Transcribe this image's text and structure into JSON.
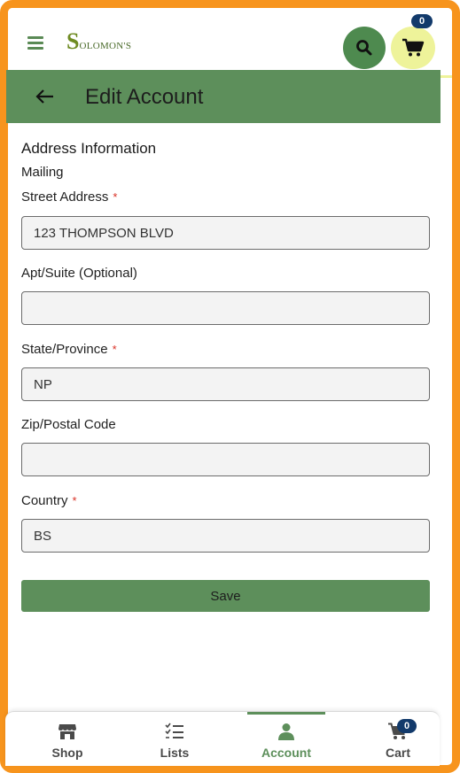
{
  "header": {
    "logo_initial": "S",
    "logo_rest": "OLOMON'S",
    "cart_count": "0",
    "icons": {
      "menu": "hamburger-menu-icon",
      "search": "search-icon",
      "cart": "cart-icon"
    }
  },
  "page": {
    "title": "Edit Account",
    "back_icon": "back-arrow-icon"
  },
  "form": {
    "section_title": "Address Information",
    "subsection_title": "Mailing",
    "fields": [
      {
        "label": "Street Address",
        "required": "*",
        "value": "123 THOMPSON BLVD",
        "placeholder": ""
      },
      {
        "label": "Apt/Suite (Optional)",
        "required": "",
        "value": "",
        "placeholder": ""
      },
      {
        "label": "State/Province",
        "required": "*",
        "value": "NP",
        "placeholder": ""
      },
      {
        "label": "Zip/Postal Code",
        "required": "",
        "value": "",
        "placeholder": ""
      },
      {
        "label": "Country",
        "required": "*",
        "value": "BS",
        "placeholder": ""
      }
    ],
    "save_label": "Save"
  },
  "bottom_nav": {
    "items": [
      {
        "label": "Shop",
        "icon": "shop-icon",
        "active": false
      },
      {
        "label": "Lists",
        "icon": "lists-icon",
        "active": false
      },
      {
        "label": "Account",
        "icon": "account-icon",
        "active": true
      },
      {
        "label": "Cart",
        "icon": "cart-icon",
        "active": false
      }
    ],
    "cart_count": "0"
  },
  "colors": {
    "frame": "#f7941d",
    "brand_green": "#5d8f5b",
    "accent_yellow": "#eef39a",
    "badge": "#123a6b",
    "required": "#d93025"
  }
}
